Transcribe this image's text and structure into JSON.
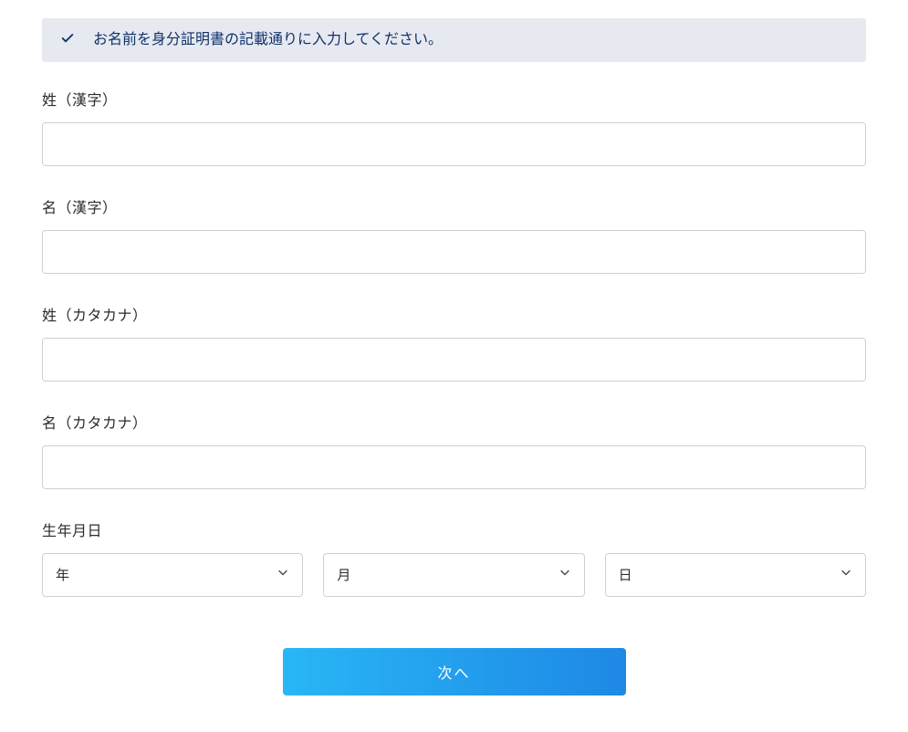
{
  "banner": {
    "text": "お名前を身分証明書の記載通りに入力してください。"
  },
  "fields": {
    "lastNameKanji": {
      "label": "姓（漢字）",
      "value": ""
    },
    "firstNameKanji": {
      "label": "名（漢字）",
      "value": ""
    },
    "lastNameKatakana": {
      "label": "姓（カタカナ）",
      "value": ""
    },
    "firstNameKatakana": {
      "label": "名（カタカナ）",
      "value": ""
    }
  },
  "dob": {
    "label": "生年月日",
    "year": {
      "placeholder": "年"
    },
    "month": {
      "placeholder": "月"
    },
    "day": {
      "placeholder": "日"
    }
  },
  "submit": {
    "label": "次へ"
  }
}
